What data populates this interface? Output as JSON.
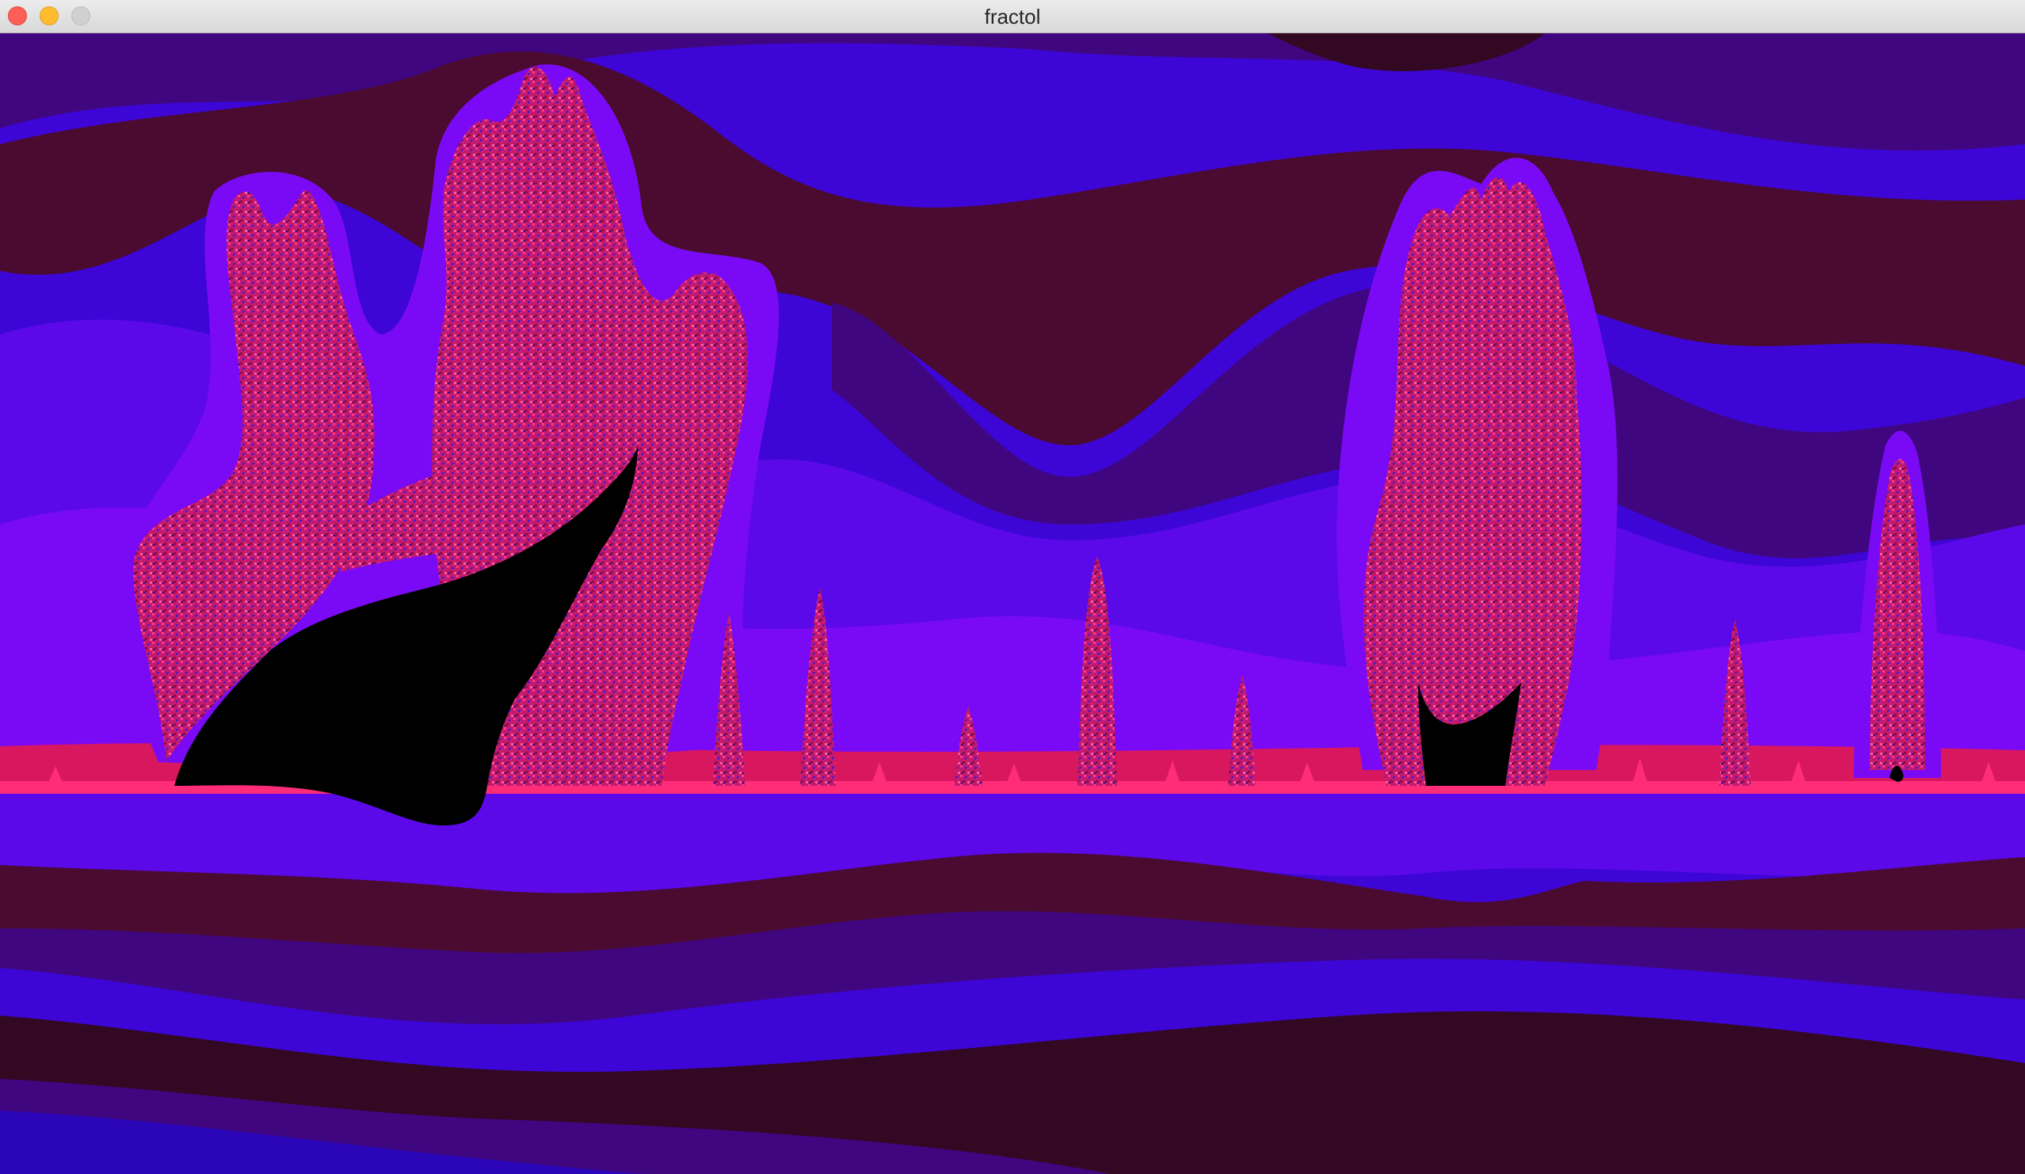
{
  "window": {
    "title": "fractol"
  },
  "titlebar_buttons": [
    "close",
    "minimize",
    "zoom"
  ],
  "palette": {
    "deep_maroon": "#330822",
    "dark_maroon": "#4b0a30",
    "indigo": "#3f0680",
    "royal_blue": "#3d06d6",
    "violet": "#5b09e8",
    "bright_violet": "#7a0af5",
    "magenta": "#d8175f",
    "hot_pink": "#ff2c78",
    "set_black": "#000000"
  },
  "fractal": {
    "name": "fractol render",
    "interior_color": "black"
  }
}
